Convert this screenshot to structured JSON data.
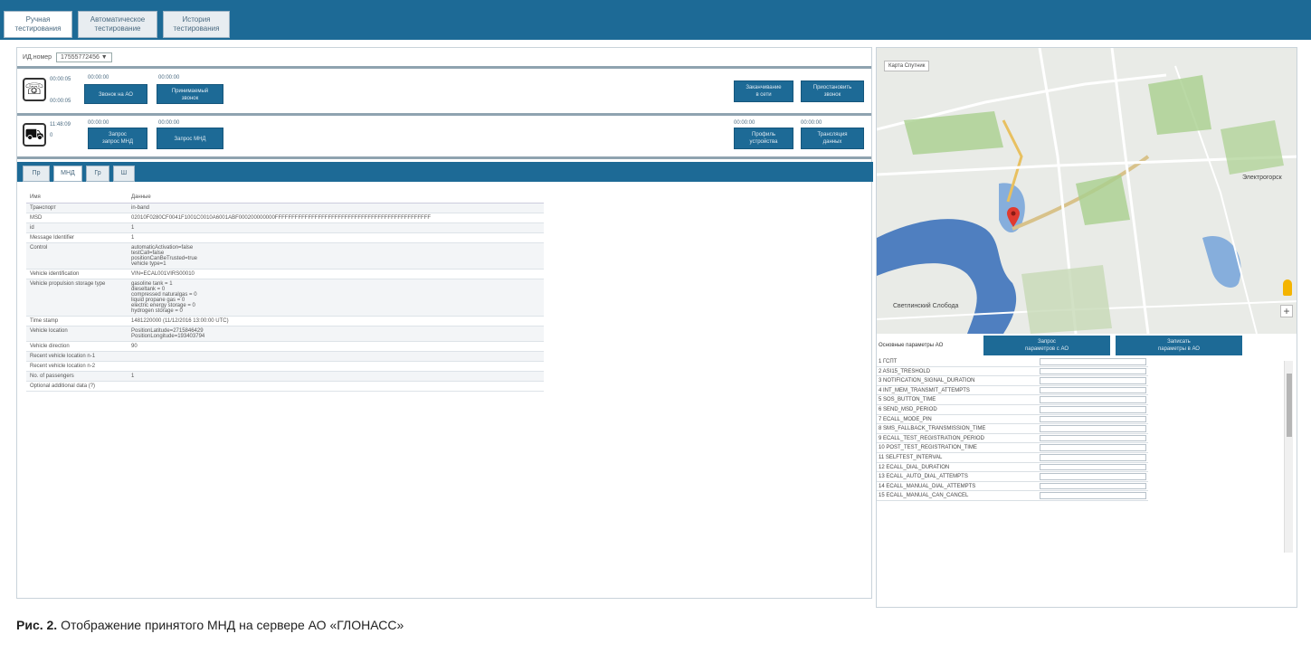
{
  "top_tabs": [
    "Ручная\nтестирования",
    "Автоматическое\nтестирование",
    "История\nтестирования"
  ],
  "imei_label": "ИД.номер",
  "imei_value": "17555772456 ▼",
  "call_panel": {
    "time1": "00:00:05",
    "time2": "00:00:05",
    "t_a": "00:00:00",
    "t_b": "00:00:00",
    "btn_call": "Звонок на АО",
    "btn_accept": "Принимаемый\nзвонок",
    "btn_hangup": "Заканчивание\nв сети",
    "btn_hold": "Приостановить\nзвонок"
  },
  "msd_panel": {
    "time1": "11:48:09",
    "count": "0",
    "t_a": "00:00:00",
    "t_b": "00:00:00",
    "t_c": "00:00:00",
    "t_d": "00:00:00",
    "btn_request": "Запрос\nзапрос МНД",
    "btn_msd": "Запрос МНД",
    "btn_profile": "Профиль\nустройства",
    "btn_transfer": "Трансляция\nданных"
  },
  "inner_tabs": [
    "Пр",
    "МНД",
    "Гр",
    "Ш"
  ],
  "grid": {
    "header_key": "Имя",
    "header_val": "Данные",
    "rows": [
      {
        "k": "Транспорт",
        "v": "in-band"
      },
      {
        "k": "MSD",
        "v": "02010F0280CF0041F1001C0010A6001ABF000200000000FFFFFFFFFFFFFFFFFFFFFFFFFFFFFFFFFFFFFFFFFFFFFFF"
      },
      {
        "k": "id",
        "v": "1"
      },
      {
        "k": "Message Identifier",
        "v": "1"
      },
      {
        "k": "Control",
        "v": "automaticActivation=false\ntestCall=false\npositionCanBeTrusted=true\nvehicle type=1"
      },
      {
        "k": "Vehicle identification",
        "v": "VIN=ECAL001VIRS00010"
      },
      {
        "k": "Vehicle propulsion storage type",
        "v": "gasoline tank = 1\ndieseltank = 0\ncompressed naturalgas = 0\nliquid propane gas = 0\nelectric energy storage = 0\nhydrogen storage = 0"
      },
      {
        "k": "Time stamp",
        "v": "1481220000 (11/12/2016 13:00:00 UTC)"
      },
      {
        "k": "Vehicle location",
        "v": "PositionLatitude=2715846429\nPositionLongitude=193403794"
      },
      {
        "k": "Vehicle direction",
        "v": "90"
      },
      {
        "k": "Recent vehicle location n-1",
        "v": ""
      },
      {
        "k": "Recent vehicle location n-2",
        "v": ""
      },
      {
        "k": "No. of passengers",
        "v": "1"
      },
      {
        "k": "Optional additional data (?)",
        "v": ""
      }
    ]
  },
  "map": {
    "maptype": "Карта  Спутник",
    "label_district": "Светлинский Слобода",
    "label_east": "Электрогорск"
  },
  "params": {
    "title": "Основные параметры АО",
    "btn_read": "Запрос\nпараметров с АО",
    "btn_write": "Записать\nпараметры в АО",
    "items": [
      "1 ГСПТ",
      "2 ASI15_TRESHOLD",
      "3 NOTIFICATION_SIGNAL_DURATION",
      "4 INT_MEM_TRANSMIT_ATTEMPTS",
      "5 SOS_BUTTON_TIME",
      "6 SEND_MSD_PERIOD",
      "7 ECALL_MODE_PIN",
      "8 SMS_FALLBACK_TRANSMISSION_TIME",
      "9 ECALL_TEST_REGISTRATION_PERIOD",
      "10 POST_TEST_REGISTRATION_TIME",
      "11 SELFTEST_INTERVAL",
      "12 ECALL_DIAL_DURATION",
      "13 ECALL_AUTO_DIAL_ATTEMPTS",
      "14 ECALL_MANUAL_DIAL_ATTEMPTS",
      "15 ECALL_MANUAL_CAN_CANCEL"
    ]
  },
  "caption_bold": "Рис. 2.",
  "caption_text": " Отображение принятого МНД на сервере АО «ГЛОНАСС»"
}
